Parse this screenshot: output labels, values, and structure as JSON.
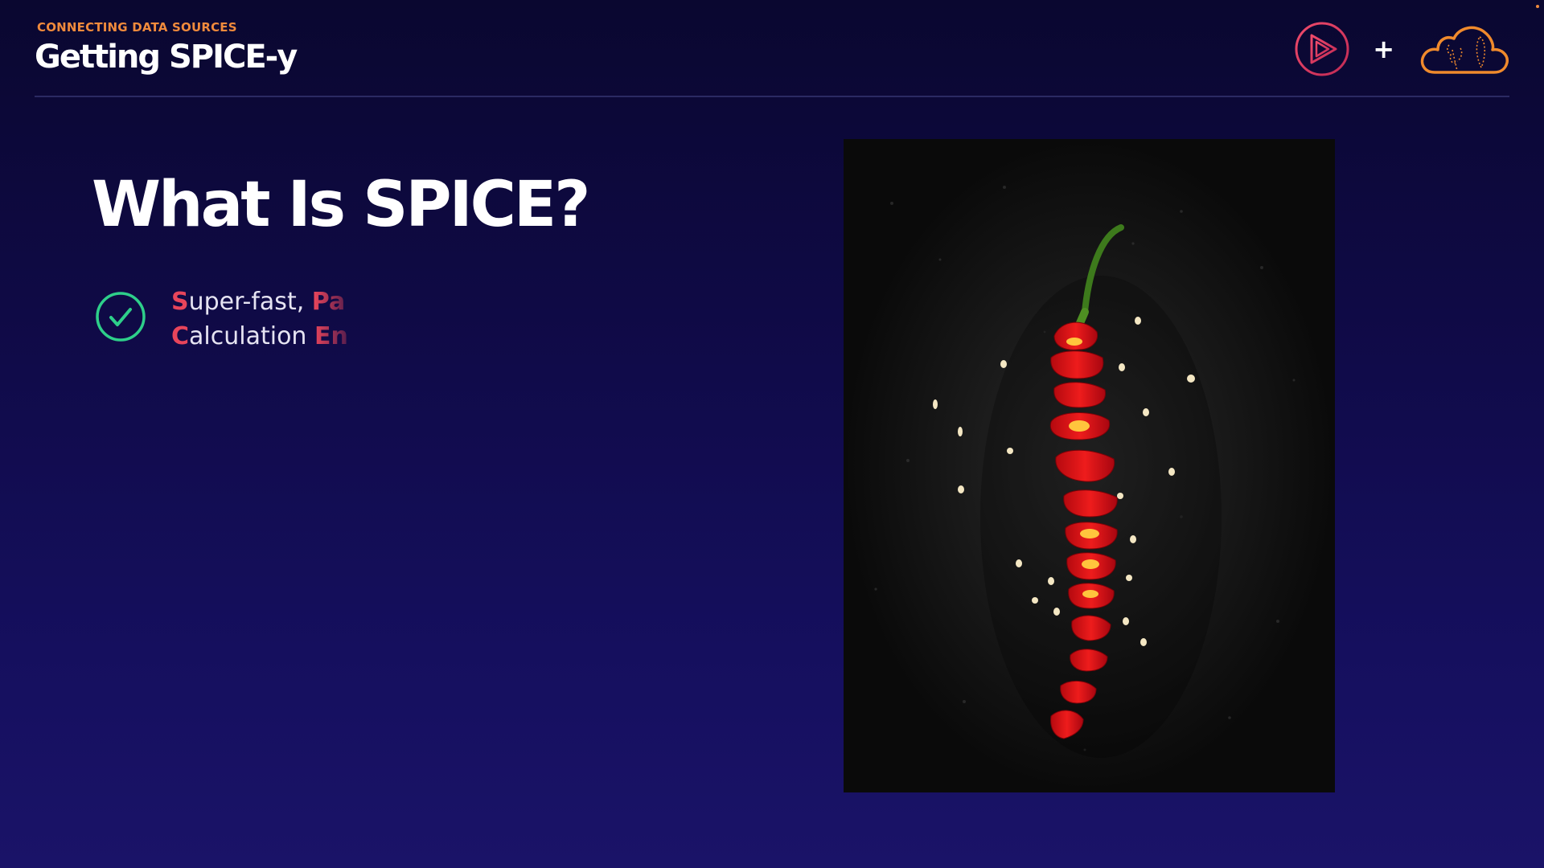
{
  "header": {
    "eyebrow": "CONNECTING DATA SOURCES",
    "title": "Getting SPICE-y",
    "plus": "+"
  },
  "slide": {
    "heading": "What Is SPICE?",
    "bullet": {
      "line1_initial_1": "S",
      "line1_rest_1": "uper-fast, ",
      "line1_initial_2": "Pa",
      "line2_initial_1": "C",
      "line2_rest_1": "alculation ",
      "line2_initial_2": "En"
    }
  },
  "colors": {
    "accent": "#e8455b",
    "eyebrow": "#f08a3c",
    "check": "#2ecf8a",
    "logo_play": "#e0345f",
    "logo_cloud": "#f08a2c"
  },
  "icons": {
    "check": "check-circle-icon",
    "play_logo": "play-logo-icon",
    "cloud_logo": "cloud-logo-icon"
  }
}
